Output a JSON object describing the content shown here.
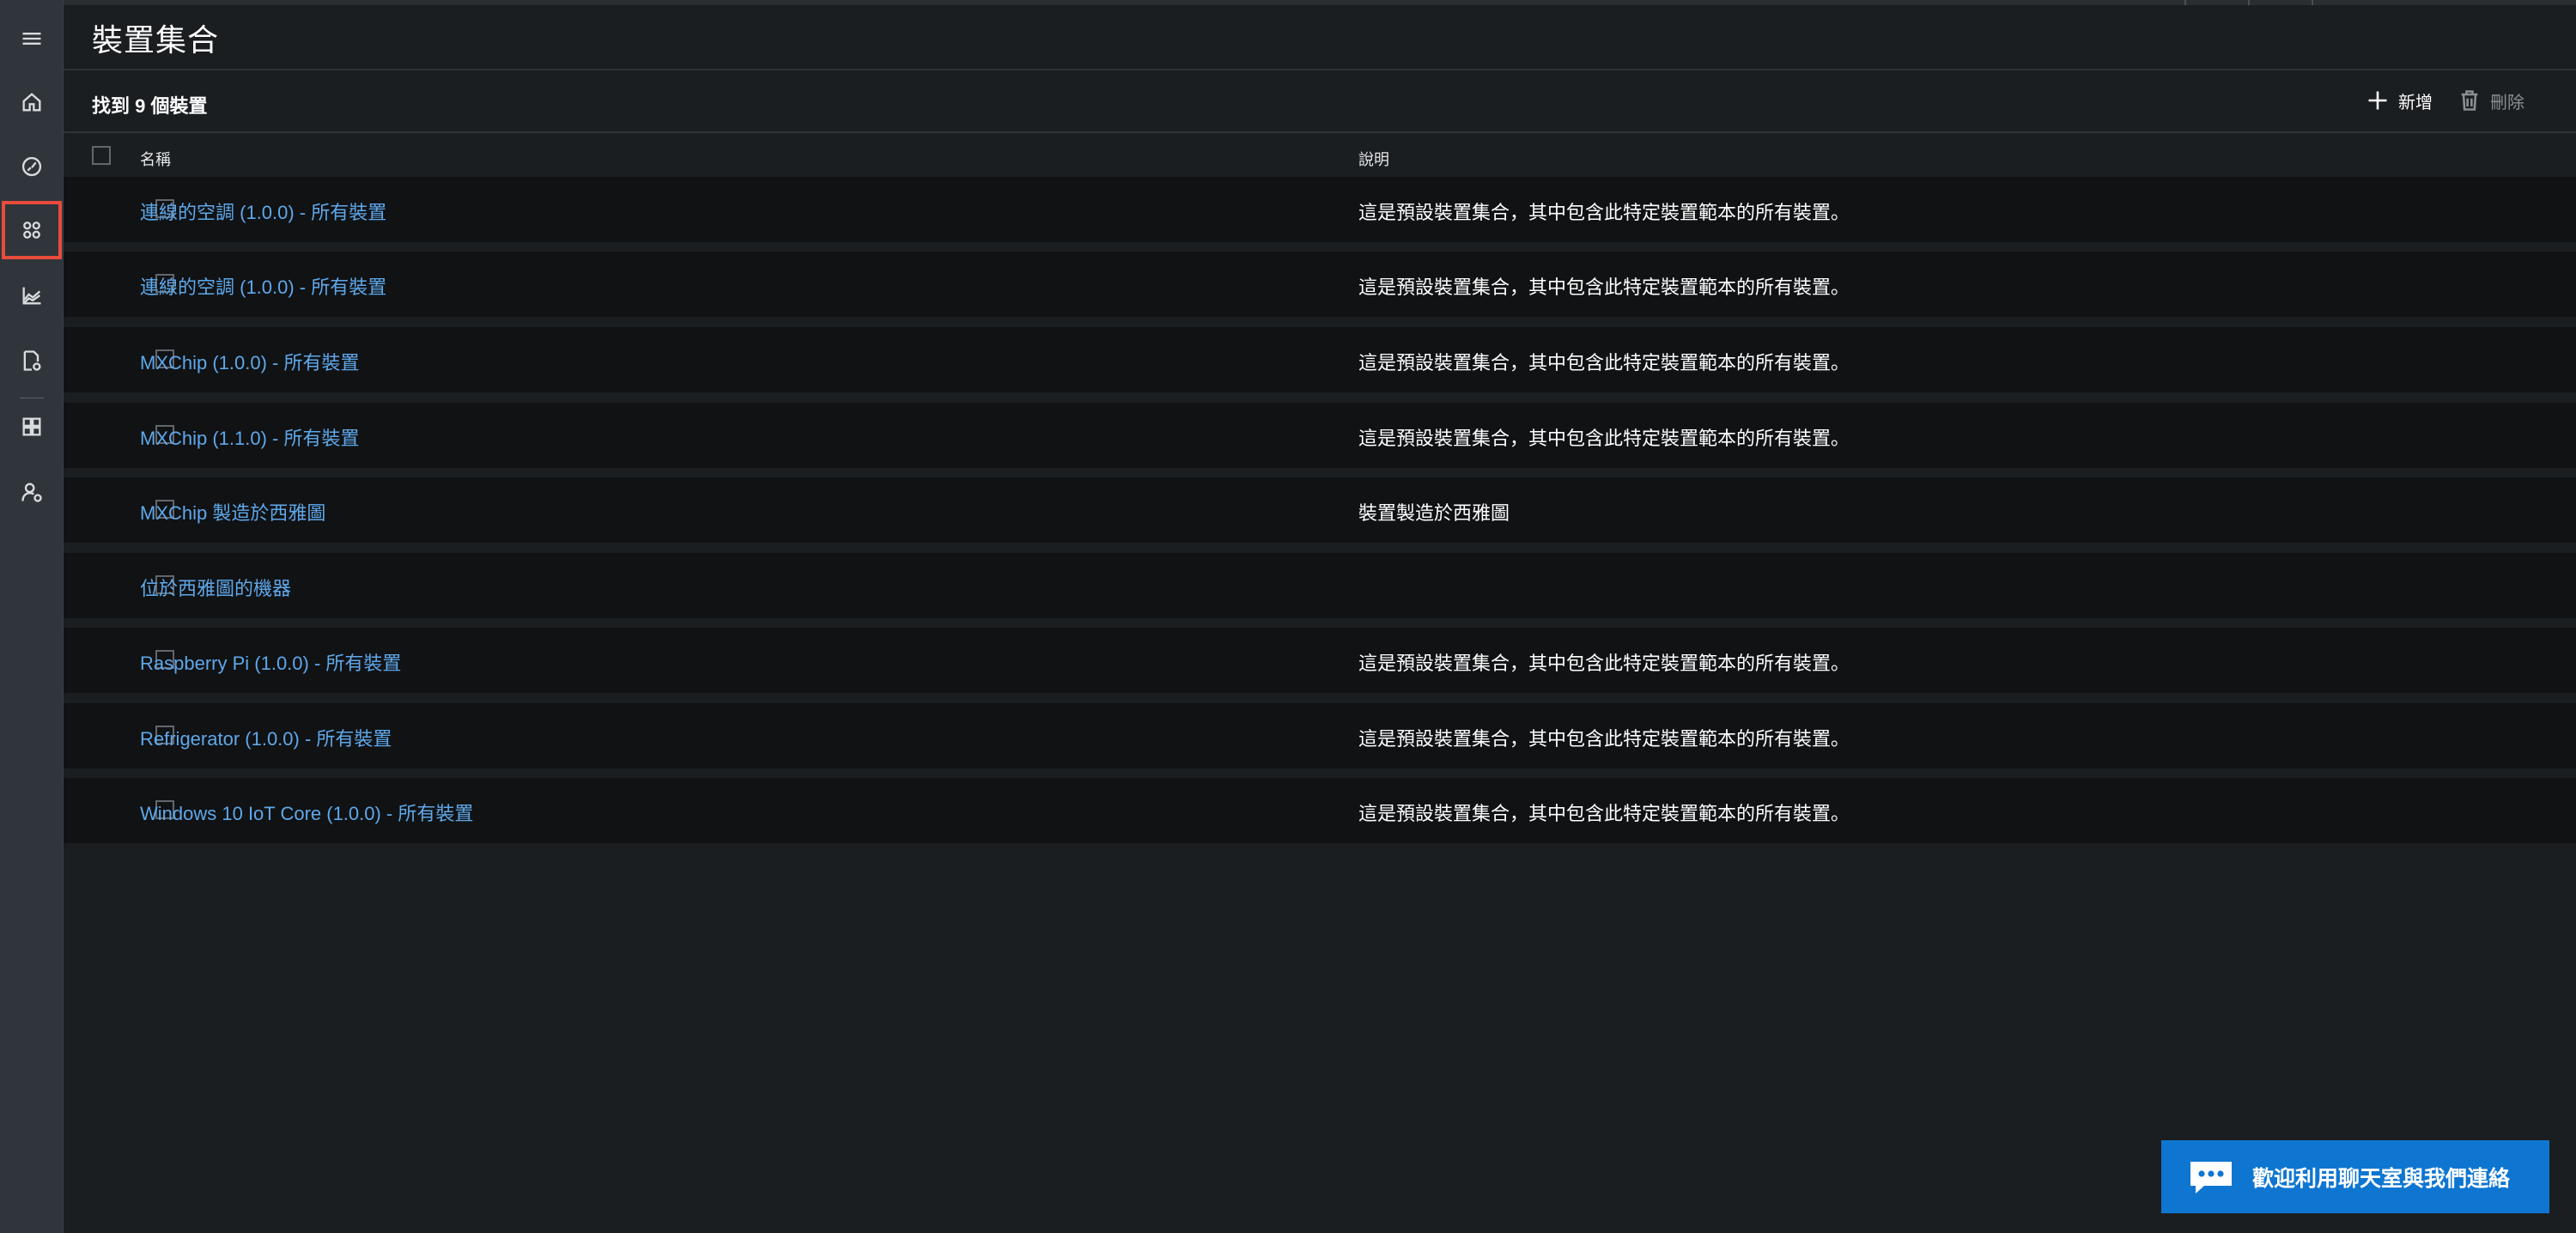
{
  "page": {
    "title": "裝置集合",
    "count_text": "找到 9 個裝置"
  },
  "rail": {
    "items": [
      {
        "icon": "hamburger-menu-icon"
      },
      {
        "icon": "home-icon"
      },
      {
        "icon": "dashboard-gauge-icon"
      },
      {
        "icon": "device-sets-icon",
        "selected": true
      },
      {
        "icon": "analytics-chart-icon"
      },
      {
        "icon": "jobs-document-icon"
      },
      {
        "icon": "app-builder-grid-icon"
      },
      {
        "icon": "administration-user-icon"
      }
    ]
  },
  "toolbar": {
    "add_label": "新增",
    "delete_label": "刪除"
  },
  "table": {
    "columns": {
      "name": "名稱",
      "description": "說明"
    },
    "rows": [
      {
        "name": "連線的空調 (1.0.0) - 所有裝置",
        "description": "這是預設裝置集合，其中包含此特定裝置範本的所有裝置。"
      },
      {
        "name": "連線的空調 (1.0.0) - 所有裝置",
        "description": "這是預設裝置集合，其中包含此特定裝置範本的所有裝置。"
      },
      {
        "name": "MXChip (1.0.0) - 所有裝置",
        "description": "這是預設裝置集合，其中包含此特定裝置範本的所有裝置。"
      },
      {
        "name": "MXChip (1.1.0) - 所有裝置",
        "description": "這是預設裝置集合，其中包含此特定裝置範本的所有裝置。"
      },
      {
        "name": "MXChip 製造於西雅圖",
        "description": "裝置製造於西雅圖"
      },
      {
        "name": "位於西雅圖的機器",
        "description": ""
      },
      {
        "name": "Raspberry Pi (1.0.0) - 所有裝置",
        "description": "這是預設裝置集合，其中包含此特定裝置範本的所有裝置。"
      },
      {
        "name": "Refrigerator (1.0.0) - 所有裝置",
        "description": "這是預設裝置集合，其中包含此特定裝置範本的所有裝置。"
      },
      {
        "name": "Windows 10 IoT Core (1.0.0) - 所有裝置",
        "description": "這是預設裝置集合，其中包含此特定裝置範本的所有裝置。"
      }
    ]
  },
  "chat": {
    "label": "歡迎利用聊天室與我們連絡",
    "icon": "chat-bubble-icon"
  },
  "colors": {
    "link": "#5fa8ea",
    "accent": "#0e76d1",
    "selected_border": "#e74c3c"
  }
}
